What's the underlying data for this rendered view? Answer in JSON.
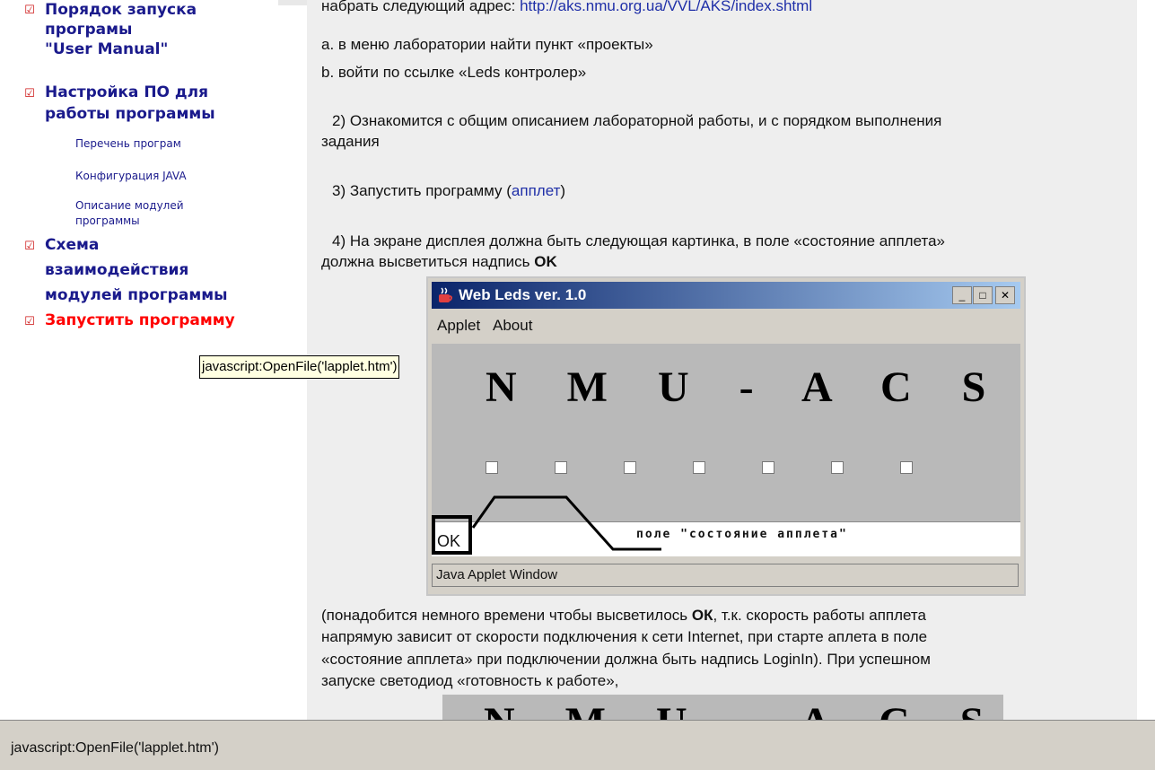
{
  "sidebar": {
    "items": [
      {
        "label": "Порядок запуска"
      },
      {
        "label": "програмы"
      },
      {
        "label": "\"User Manual\""
      },
      {
        "label": "Настройка ПО для"
      },
      {
        "label": "работы программы"
      },
      {
        "sub": "Перечень програм"
      },
      {
        "sub": "Конфигурация JAVA"
      },
      {
        "sub": "Описание модулей"
      },
      {
        "sub": "программы"
      },
      {
        "label": "Схема"
      },
      {
        "label": "взаимодействия"
      },
      {
        "label": "модулей программы"
      },
      {
        "label": "Запустить программу"
      }
    ],
    "check_glyph": "☑"
  },
  "main": {
    "line_address_prefix": "набрать следующий адрес: ",
    "line_address_link": "http://aks.nmu.org.ua/VVL/AKS/index.shtml",
    "line_a": "a. в меню лаборатории найти пункт «проекты»",
    "line_b": "b. войти по ссылке «Leds контролер»",
    "step2_line1": "2) Ознакомится с общим описанием лабораторной работы, и с порядком выполнения",
    "step2_line2": "задания",
    "step3_prefix": "3) Запустить программу (",
    "step3_link": "апплет",
    "step3_suffix": ")",
    "step4_line1": "4) На экране дисплея должна быть следующая картинка, в поле «состояние апплета»",
    "step4_line2_prefix": "должна высветиться надпись ",
    "step4_line2_bold": "OK",
    "note_line1_prefix": "(понадобится немного времени чтобы высветилось ",
    "note_line1_bold": "ОК",
    "note_line1_suffix": ", т.к. скорость работы апплета",
    "note_line2": "напрямую зависит от скорости подключения к сети Internet, при старте аплета в поле",
    "note_line3": "«состояние апплета» при подключении должна быть надпись LoginIn). При успешном",
    "note_line4": "запуске светодиод «готовность к работе»,"
  },
  "applet": {
    "title": "Web Leds ver. 1.0",
    "menu": [
      "Applet",
      "About"
    ],
    "heading": "N M U - A C S",
    "led_count": 7,
    "status_value": "OK",
    "status_field_label": "поле \"состояние апплета\"",
    "window_status": "Java Applet Window",
    "buttons": {
      "minimize": "_",
      "maximize": "□",
      "close": "✕"
    }
  },
  "applet2": {
    "heading": "N M U - A C S"
  },
  "tooltip": "javascript:OpenFile('lapplet.htm')",
  "statusbar": {
    "text": "javascript:OpenFile('lapplet.htm')"
  },
  "colors": {
    "sidebar_link": "#1a1a8c",
    "sidebar_active": "#ff0000",
    "link": "#1f2fa8",
    "applet_title_start": "#0a246a",
    "applet_title_end": "#a6caf0"
  }
}
